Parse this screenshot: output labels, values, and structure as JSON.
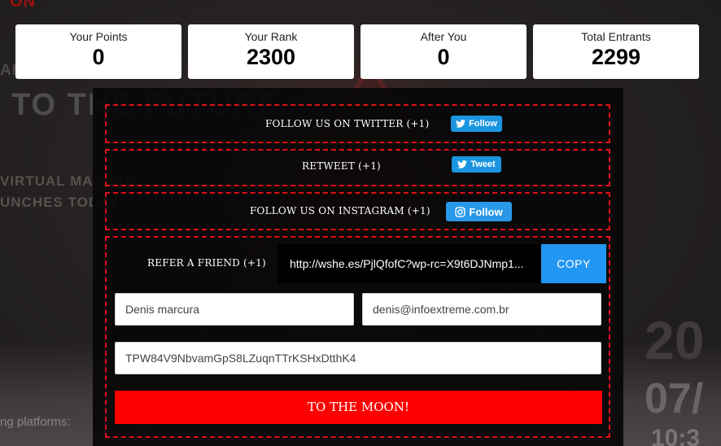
{
  "background": {
    "brand_fragment": "ON",
    "heading_fragment": "AI",
    "title": "TO THE FUTURE",
    "line1": "VIRTUAL MACHINE",
    "line2": "UNCHES TODAY",
    "platforms": "ng platforms:",
    "right_large": "20",
    "right_mid": "07/",
    "right_small": "10:3"
  },
  "stats": [
    {
      "label": "Your Points",
      "value": "0"
    },
    {
      "label": "Your Rank",
      "value": "2300"
    },
    {
      "label": "After You",
      "value": "0"
    },
    {
      "label": "Total Entrants",
      "value": "2299"
    }
  ],
  "tasks": {
    "twitter_follow": {
      "label": "FOLLOW US ON TWITTER (+1)",
      "button": "Follow"
    },
    "retweet": {
      "label": "RETWEET (+1)",
      "button": "Tweet"
    },
    "instagram_follow": {
      "label": "FOLLOW US ON INSTAGRAM (+1)",
      "button": "Follow"
    },
    "refer": {
      "label": "REFER A FRIEND (+1)",
      "url": "http://wshe.es/PjlQfofC?wp-rc=X9t6DJNmp1...",
      "copy_label": "COPY"
    }
  },
  "form": {
    "name_value": "Denis marcura",
    "email_value": "denis@infoextreme.com.br",
    "wallet_value": "TPW84V9NbvamGpS8LZuqnTTrKSHxDtthK4",
    "submit_label": "TO THE MOON!"
  },
  "colors": {
    "accent_red": "#ff0000",
    "dash_border": "#e0101a",
    "twitter_blue": "#1b95e0",
    "copy_blue": "#2196f3"
  },
  "icons": {
    "twitter": "twitter-bird-icon",
    "instagram": "instagram-icon"
  }
}
